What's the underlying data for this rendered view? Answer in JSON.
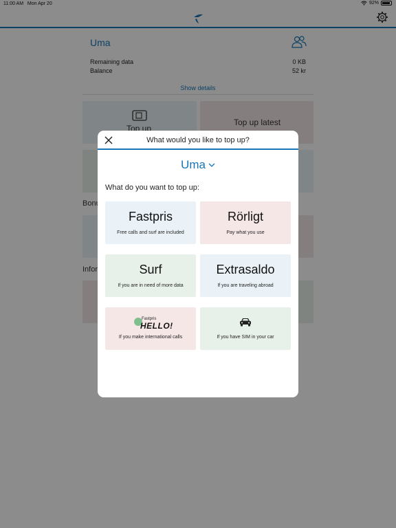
{
  "status_bar": {
    "time": "11:00 AM",
    "date": "Mon Apr 20",
    "battery": "92%"
  },
  "background": {
    "account_name": "Uma",
    "rows": [
      {
        "label": "Remaining data",
        "value": "0 KB"
      },
      {
        "label": "Balance",
        "value": "52 kr"
      }
    ],
    "show_details": "Show details",
    "tile_top_up": "Top up",
    "tile_top_up_latest": "Top up latest",
    "section_bonus": "Bonu",
    "section_info": "Infor"
  },
  "modal": {
    "title": "What would you like to top up?",
    "account": "Uma",
    "question": "What do you want to top up:",
    "options": [
      {
        "title": "Fastpris",
        "desc": "Free calls and surf are included",
        "color": "#eaf2f7"
      },
      {
        "title": "Rörligt",
        "desc": "Pay what you use",
        "color": "#f6e7e7"
      },
      {
        "title": "Surf",
        "desc": "If you are in need of more data",
        "color": "#e8f0ea"
      },
      {
        "title": "Extrasaldo",
        "desc": "If you are traveling abroad",
        "color": "#eaf2f7"
      },
      {
        "title": "",
        "logo_small": "Fastpris",
        "logo_big": "HELLO!",
        "desc": "If you make international calls",
        "color": "#f6e7e7"
      },
      {
        "title": "",
        "icon": "car-icon",
        "desc": "If you have SIM in your car",
        "color": "#e8f0ea"
      }
    ]
  },
  "colors": {
    "accent": "#1776b8"
  }
}
